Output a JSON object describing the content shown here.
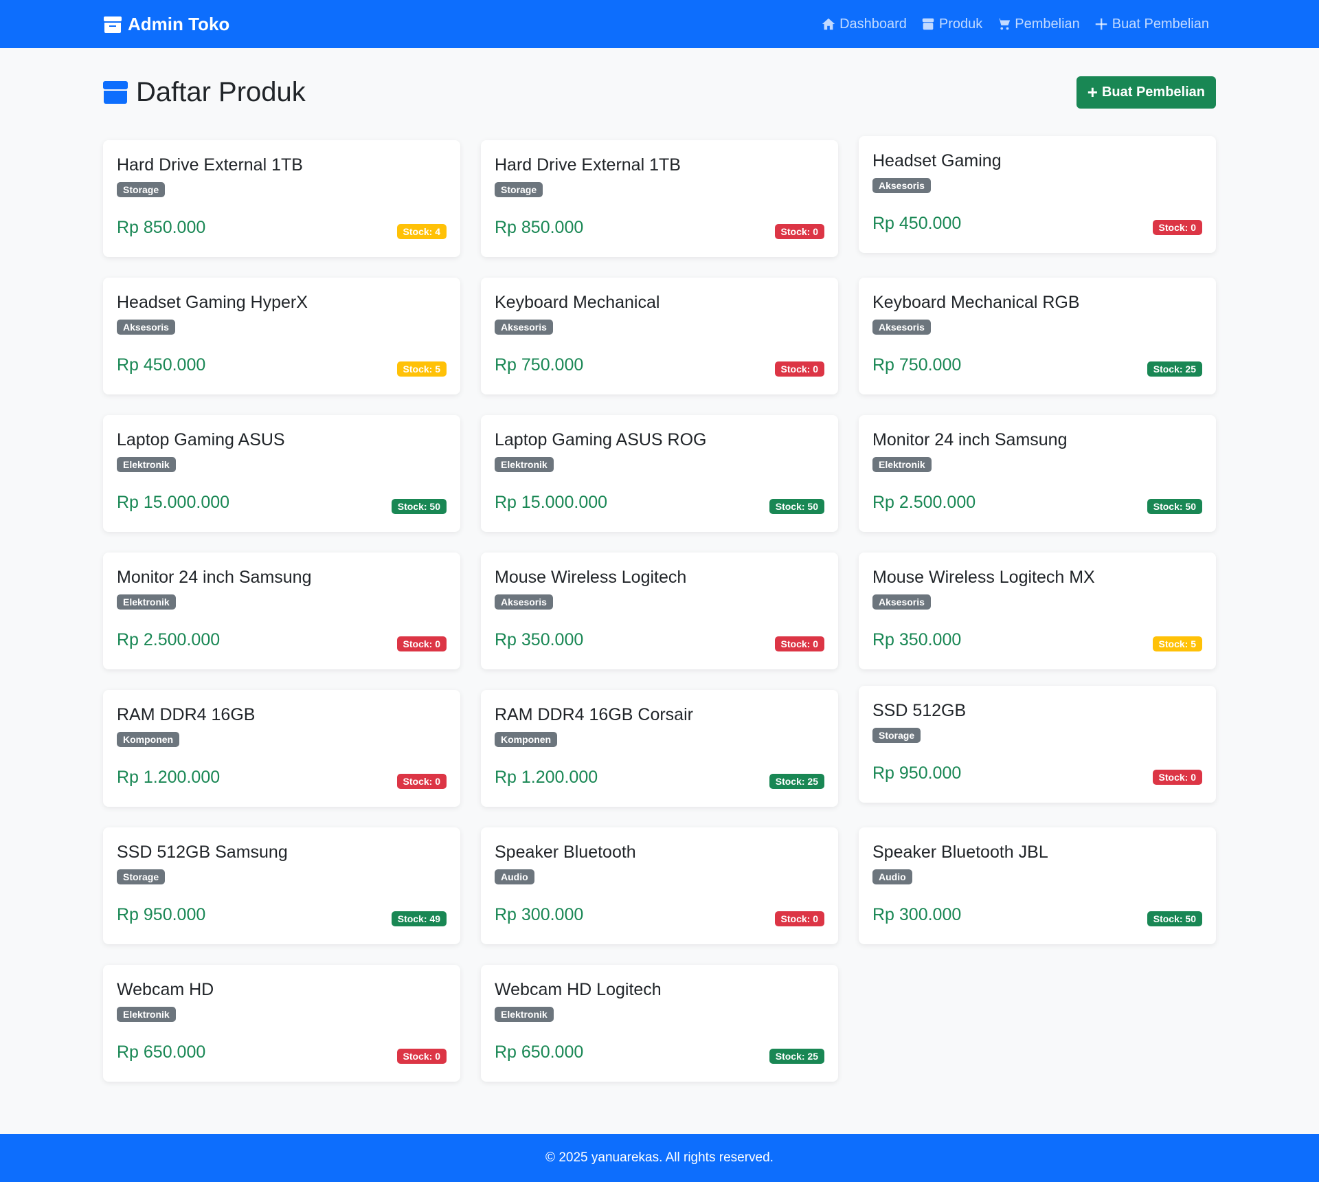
{
  "navbar": {
    "brand": "Admin Toko",
    "links": [
      {
        "label": "Dashboard",
        "icon": "home-icon"
      },
      {
        "label": "Produk",
        "icon": "box-icon"
      },
      {
        "label": "Pembelian",
        "icon": "cart-icon"
      },
      {
        "label": "Buat Pembelian",
        "icon": "plus-icon"
      }
    ]
  },
  "page": {
    "title": "Daftar Produk",
    "create_button": "Buat Pembelian"
  },
  "products": [
    {
      "name": "Hard Drive External 1TB",
      "category": "Storage",
      "price": "Rp 850.000",
      "stock": "Stock: 4",
      "status": "warn"
    },
    {
      "name": "Hard Drive External 1TB",
      "category": "Storage",
      "price": "Rp 850.000",
      "stock": "Stock: 0",
      "status": "danger"
    },
    {
      "name": "Headset Gaming",
      "category": "Aksesoris",
      "price": "Rp 450.000",
      "stock": "Stock: 0",
      "status": "danger"
    },
    {
      "name": "Headset Gaming HyperX",
      "category": "Aksesoris",
      "price": "Rp 450.000",
      "stock": "Stock: 5",
      "status": "warn"
    },
    {
      "name": "Keyboard Mechanical",
      "category": "Aksesoris",
      "price": "Rp 750.000",
      "stock": "Stock: 0",
      "status": "danger"
    },
    {
      "name": "Keyboard Mechanical RGB",
      "category": "Aksesoris",
      "price": "Rp 750.000",
      "stock": "Stock: 25",
      "status": "ok"
    },
    {
      "name": "Laptop Gaming ASUS",
      "category": "Elektronik",
      "price": "Rp 15.000.000",
      "stock": "Stock: 50",
      "status": "ok"
    },
    {
      "name": "Laptop Gaming ASUS ROG",
      "category": "Elektronik",
      "price": "Rp 15.000.000",
      "stock": "Stock: 50",
      "status": "ok"
    },
    {
      "name": "Monitor 24 inch Samsung",
      "category": "Elektronik",
      "price": "Rp 2.500.000",
      "stock": "Stock: 50",
      "status": "ok"
    },
    {
      "name": "Monitor 24 inch Samsung",
      "category": "Elektronik",
      "price": "Rp 2.500.000",
      "stock": "Stock: 0",
      "status": "danger"
    },
    {
      "name": "Mouse Wireless Logitech",
      "category": "Aksesoris",
      "price": "Rp 350.000",
      "stock": "Stock: 0",
      "status": "danger"
    },
    {
      "name": "Mouse Wireless Logitech MX",
      "category": "Aksesoris",
      "price": "Rp 350.000",
      "stock": "Stock: 5",
      "status": "warn"
    },
    {
      "name": "RAM DDR4 16GB",
      "category": "Komponen",
      "price": "Rp 1.200.000",
      "stock": "Stock: 0",
      "status": "danger"
    },
    {
      "name": "RAM DDR4 16GB Corsair",
      "category": "Komponen",
      "price": "Rp 1.200.000",
      "stock": "Stock: 25",
      "status": "ok"
    },
    {
      "name": "SSD 512GB",
      "category": "Storage",
      "price": "Rp 950.000",
      "stock": "Stock: 0",
      "status": "danger"
    },
    {
      "name": "SSD 512GB Samsung",
      "category": "Storage",
      "price": "Rp 950.000",
      "stock": "Stock: 49",
      "status": "ok"
    },
    {
      "name": "Speaker Bluetooth",
      "category": "Audio",
      "price": "Rp 300.000",
      "stock": "Stock: 0",
      "status": "danger"
    },
    {
      "name": "Speaker Bluetooth JBL",
      "category": "Audio",
      "price": "Rp 300.000",
      "stock": "Stock: 50",
      "status": "ok"
    },
    {
      "name": "Webcam HD",
      "category": "Elektronik",
      "price": "Rp 650.000",
      "stock": "Stock: 0",
      "status": "danger"
    },
    {
      "name": "Webcam HD Logitech",
      "category": "Elektronik",
      "price": "Rp 650.000",
      "stock": "Stock: 25",
      "status": "ok"
    }
  ],
  "footer": {
    "text": "© 2025 yanuarekas. All rights reserved."
  },
  "colors": {
    "primary": "#0d6efd",
    "success": "#198754",
    "warning": "#ffc107",
    "danger": "#dc3545",
    "secondary": "#6c757d"
  }
}
